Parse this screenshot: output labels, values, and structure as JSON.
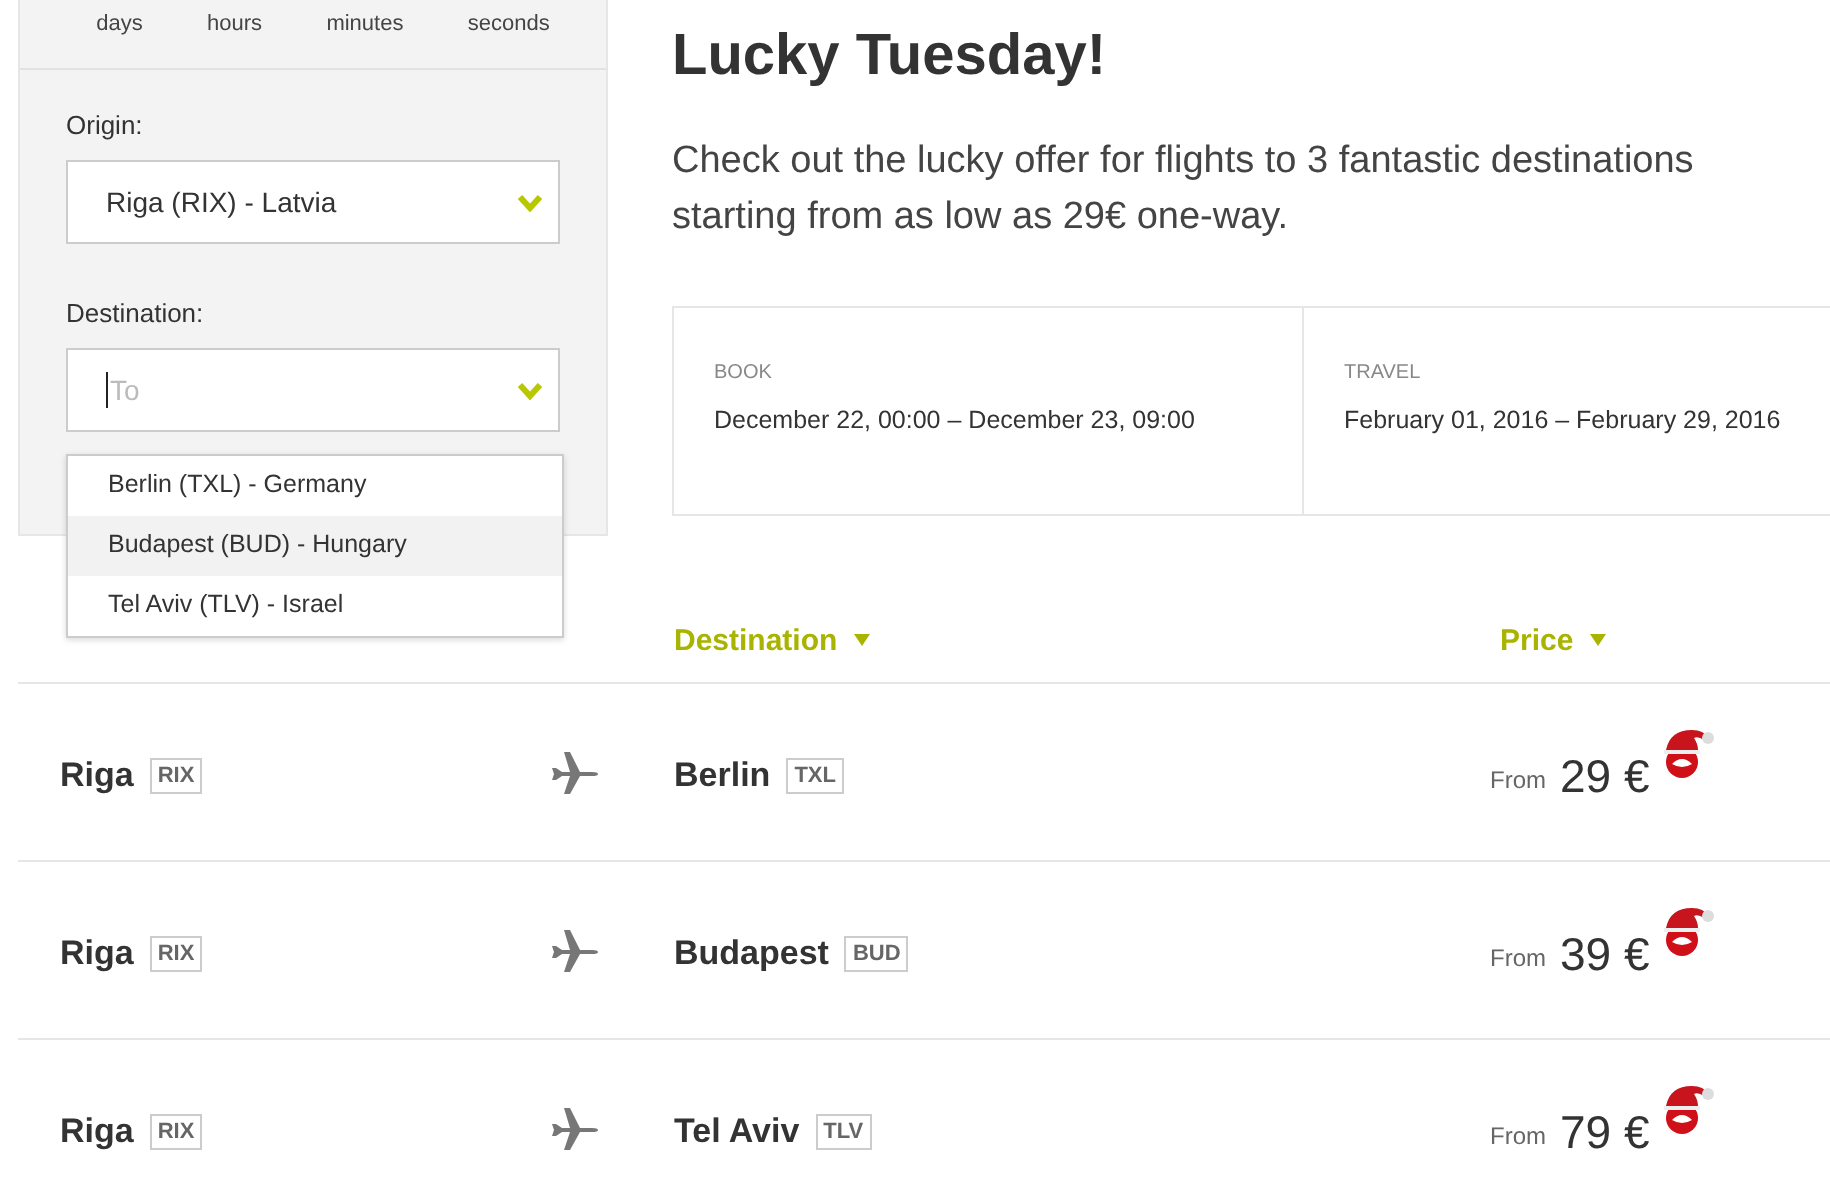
{
  "countdown": {
    "units": [
      "days",
      "hours",
      "minutes",
      "seconds"
    ]
  },
  "search": {
    "origin": {
      "label": "Origin:",
      "value": "Riga (RIX) - Latvia"
    },
    "destination": {
      "label": "Destination:",
      "placeholder": "To",
      "expanded": true,
      "options": [
        {
          "label": "Berlin (TXL) - Germany",
          "selected": false
        },
        {
          "label": "Budapest (BUD) - Hungary",
          "selected": true
        },
        {
          "label": "Tel Aviv (TLV) - Israel",
          "selected": false
        }
      ]
    }
  },
  "offer": {
    "title": "Lucky Tuesday!",
    "description": "Check out the lucky offer for flights to 3 fantastic destinations starting from as low as 29€ one-way.",
    "periods": [
      {
        "label": "BOOK",
        "value": "December 22, 00:00 – December 23, 09:00"
      },
      {
        "label": "TRAVEL",
        "value": "February 01, 2016 – February 29, 2016"
      }
    ]
  },
  "table": {
    "columns": [
      {
        "label": "Destination"
      },
      {
        "label": "Price"
      }
    ],
    "rows": [
      {
        "origin": "Riga",
        "origin_code": "RIX",
        "destination": "Berlin",
        "destination_code": "TXL",
        "price_prefix": "From",
        "price": "29 €"
      },
      {
        "origin": "Riga",
        "origin_code": "RIX",
        "destination": "Budapest",
        "destination_code": "BUD",
        "price_prefix": "From",
        "price": "39 €"
      },
      {
        "origin": "Riga",
        "origin_code": "RIX",
        "destination": "Tel Aviv",
        "destination_code": "TLV",
        "price_prefix": "From",
        "price": "79 €"
      }
    ]
  }
}
